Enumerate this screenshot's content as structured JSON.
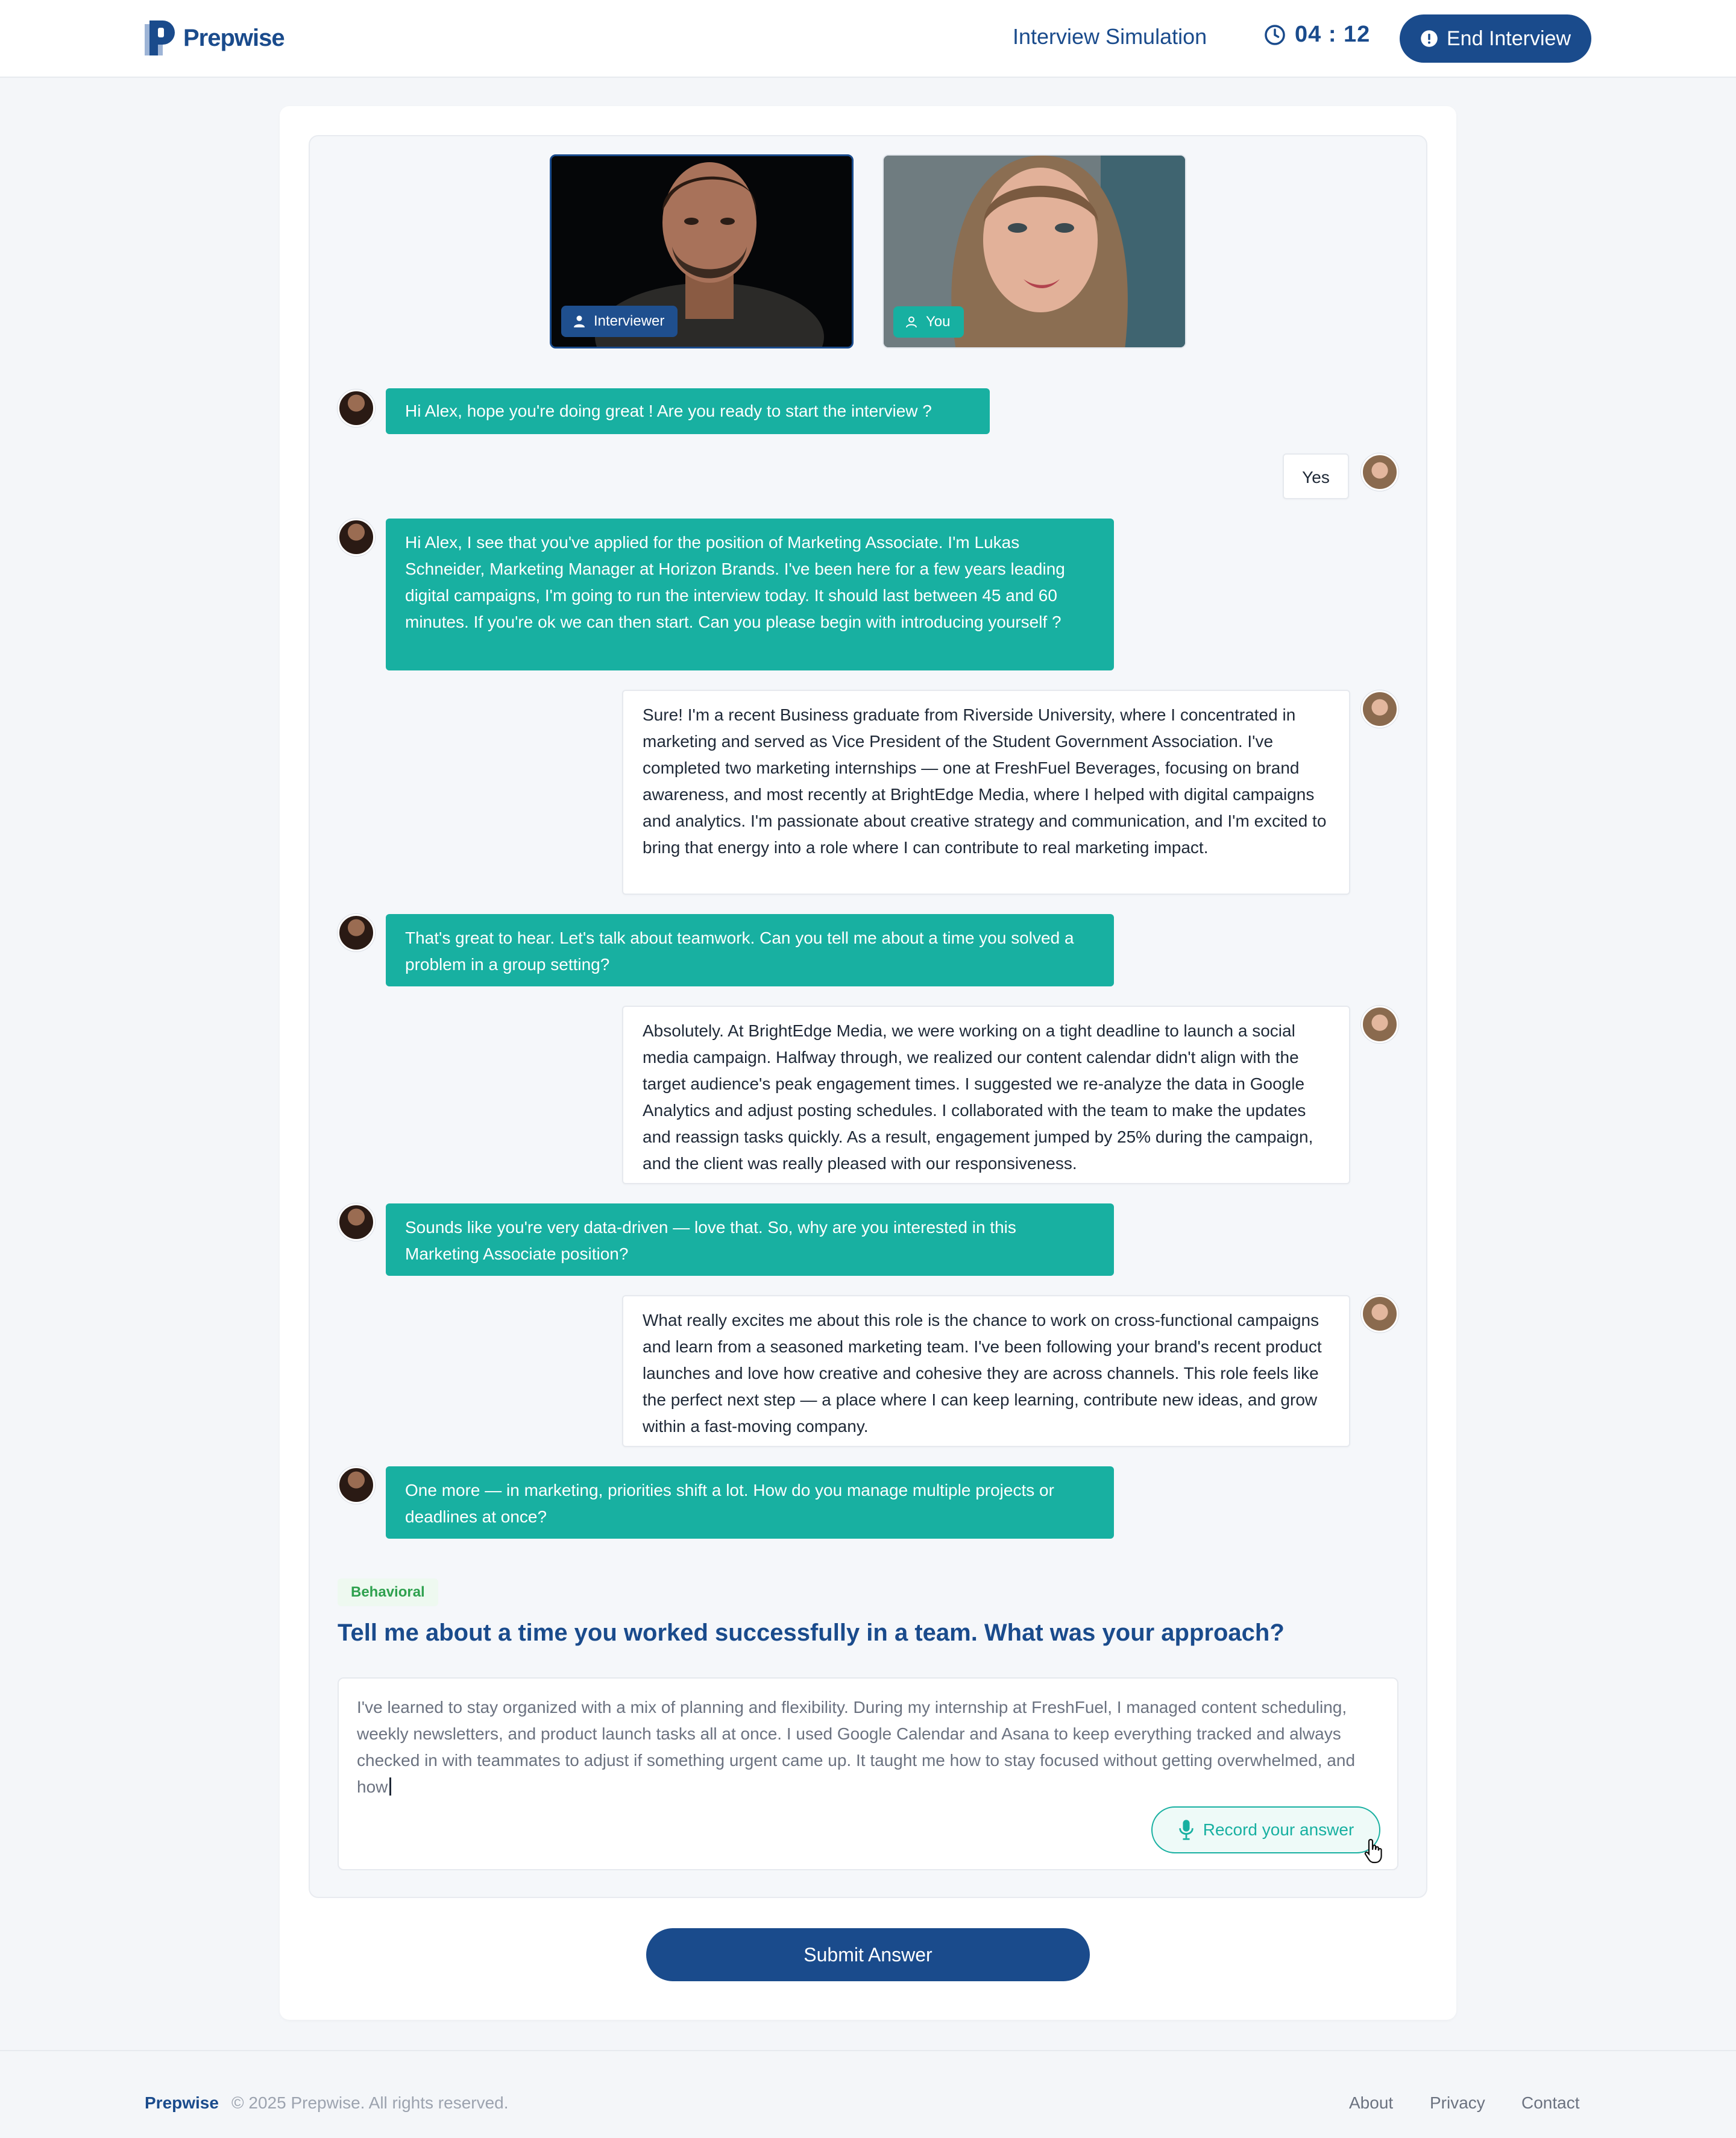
{
  "header": {
    "brand": "Prepwise",
    "nav_title": "Interview Simulation",
    "timer": "04 : 12",
    "end_button": "End Interview"
  },
  "videos": {
    "interviewer_label": "Interviewer",
    "you_label": "You"
  },
  "messages": [
    {
      "from": "interviewer",
      "text": "Hi Alex, hope you're doing great ! Are you ready to start the interview ?"
    },
    {
      "from": "you",
      "text": "Yes"
    },
    {
      "from": "interviewer",
      "text": "Hi Alex,  I see that you've applied for the position of Marketing Associate. I'm Lukas Schneider, Marketing Manager at Horizon Brands. I've been here for a few years leading digital campaigns, I'm going to run the interview today. It should last between 45 and 60 minutes. If you're ok we can then start. Can you please begin with introducing yourself ?"
    },
    {
      "from": "you",
      "text": "Sure! I'm a recent Business graduate from Riverside University, where I concentrated in marketing and served as Vice President of the Student Government Association. I've completed two marketing internships — one at FreshFuel Beverages, focusing on brand awareness, and most recently at BrightEdge Media, where I helped with digital campaigns and analytics. I'm passionate about creative strategy and communication, and I'm excited to bring that energy into a role where I can contribute to real marketing impact."
    },
    {
      "from": "interviewer",
      "text": "That's great to hear. Let's talk about teamwork. Can you tell me about a time you solved a problem in a group setting?"
    },
    {
      "from": "you",
      "text": "Absolutely. At BrightEdge Media, we were working on a tight deadline to launch a social media campaign. Halfway through, we realized our content calendar didn't align with the target audience's peak engagement times. I suggested we re-analyze the data in Google Analytics and adjust posting schedules. I collaborated with the team to make the updates and reassign tasks quickly. As a result, engagement jumped by 25% during the campaign, and the client was really pleased with our responsiveness."
    },
    {
      "from": "interviewer",
      "text": "Sounds like you're very data-driven — love that. So, why are you interested in this Marketing Associate position?"
    },
    {
      "from": "you",
      "text": "What really excites me about this role is the chance to work on cross-functional campaigns and learn from a seasoned marketing team. I've been following your brand's recent product launches and love how creative and cohesive they are across channels. This role feels like the perfect next step — a place where I can keep learning, contribute new ideas, and grow within a fast-moving company."
    },
    {
      "from": "interviewer",
      "text": "One more — in marketing, priorities shift a lot. How do you manage multiple projects or deadlines at once?"
    }
  ],
  "question": {
    "category": "Behavioral",
    "text": "Tell me about a time you worked successfully in a team. What was your approach?",
    "answer_draft": "I've learned to stay organized with a mix of planning and flexibility. During my internship at FreshFuel, I managed content scheduling, weekly newsletters, and product launch tasks all at once. I used Google Calendar and Asana to keep everything tracked and always checked in with teammates to adjust if something urgent came up. It taught me how to stay focused without getting overwhelmed, and how",
    "record_button": "Record your answer"
  },
  "submit_button": "Submit Answer",
  "footer": {
    "brand": "Prepwise",
    "copyright": "© 2025 Prepwise. All rights reserved.",
    "links": [
      "About",
      "Privacy",
      "Contact"
    ]
  },
  "colors": {
    "primary": "#1a4b8c",
    "teal": "#18b0a1",
    "behavioral_green": "#2fa14f"
  }
}
